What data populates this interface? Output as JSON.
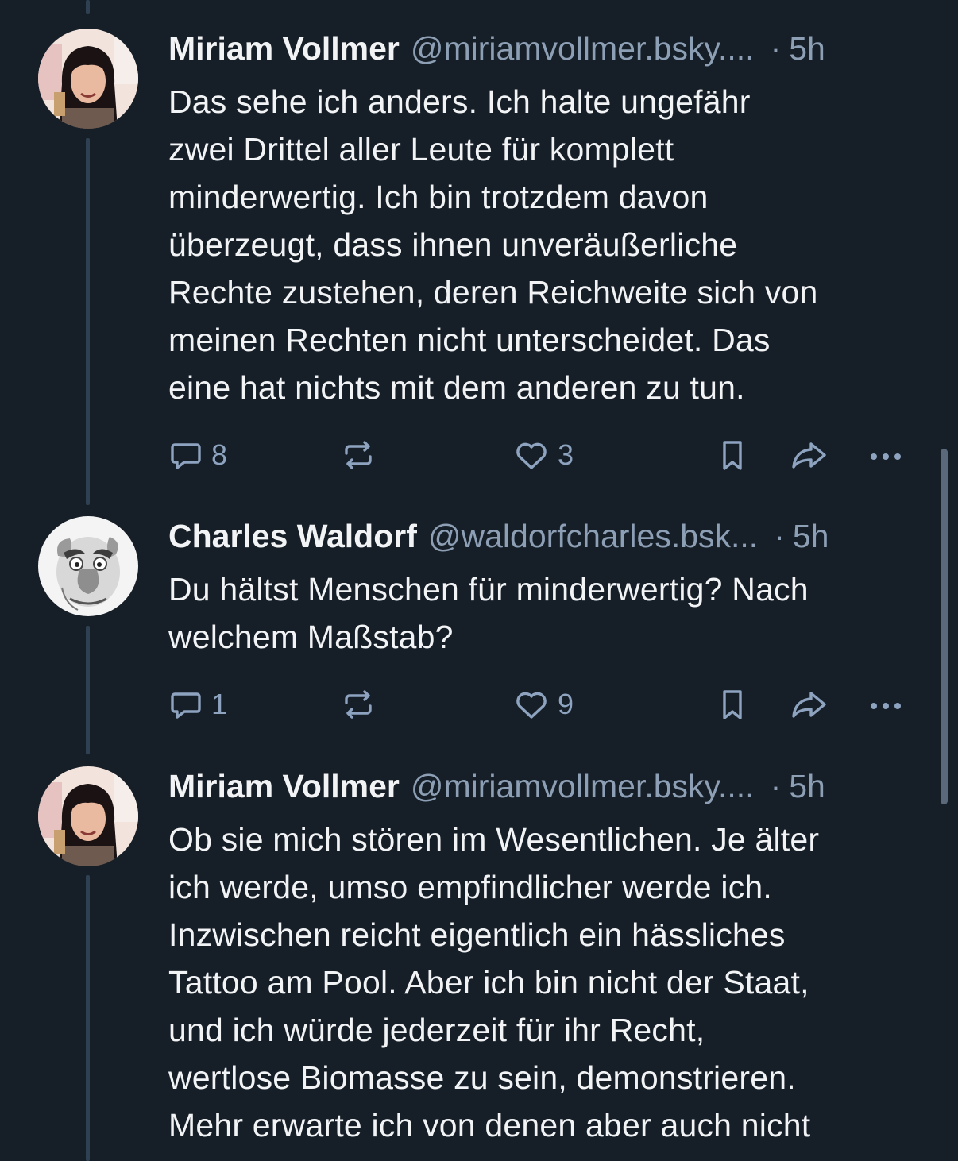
{
  "posts": [
    {
      "author": "Miriam Vollmer",
      "handle": "@miriamvollmer.bsky....",
      "separator": "·",
      "time": "5h",
      "text": "Das sehe ich anders. Ich halte ungefähr\nzwei Drittel aller Leute für komplett\nminderwertig. Ich bin trotzdem davon\nüberzeugt, dass ihnen unveräußerliche\nRechte zustehen, deren Reichweite sich von\nmeinen Rechten nicht unterscheidet. Das\neine hat nichts mit dem anderen zu tun.",
      "replies": "8",
      "reposts": "",
      "likes": "3"
    },
    {
      "author": "Charles Waldorf",
      "handle": "@waldorfcharles.bsk...",
      "separator": "·",
      "time": "5h",
      "text": "Du hältst Menschen für minderwertig? Nach\nwelchem Maßstab?",
      "replies": "1",
      "reposts": "",
      "likes": "9"
    },
    {
      "author": "Miriam Vollmer",
      "handle": "@miriamvollmer.bsky....",
      "separator": "·",
      "time": "5h",
      "text": "Ob sie mich stören im Wesentlichen. Je älter\nich werde, umso empfindlicher werde ich.\nInzwischen reicht eigentlich ein hässliches\nTattoo am Pool. Aber ich bin nicht der Staat,\nund ich würde jederzeit für ihr Recht,\nwertlose Biomasse zu sein, demonstrieren.\nMehr erwarte ich von denen aber auch nicht"
    }
  ],
  "icons": {
    "reply": "speech-bubble-icon",
    "repost": "repost-arrows-icon",
    "like": "heart-icon",
    "bookmark": "bookmark-icon",
    "share": "share-arrow-icon",
    "more": "ellipsis-icon"
  },
  "colors": {
    "background": "#161e27",
    "text": "#f1f3f5",
    "muted": "#8d9fb5",
    "thread_line": "#2e4052"
  }
}
